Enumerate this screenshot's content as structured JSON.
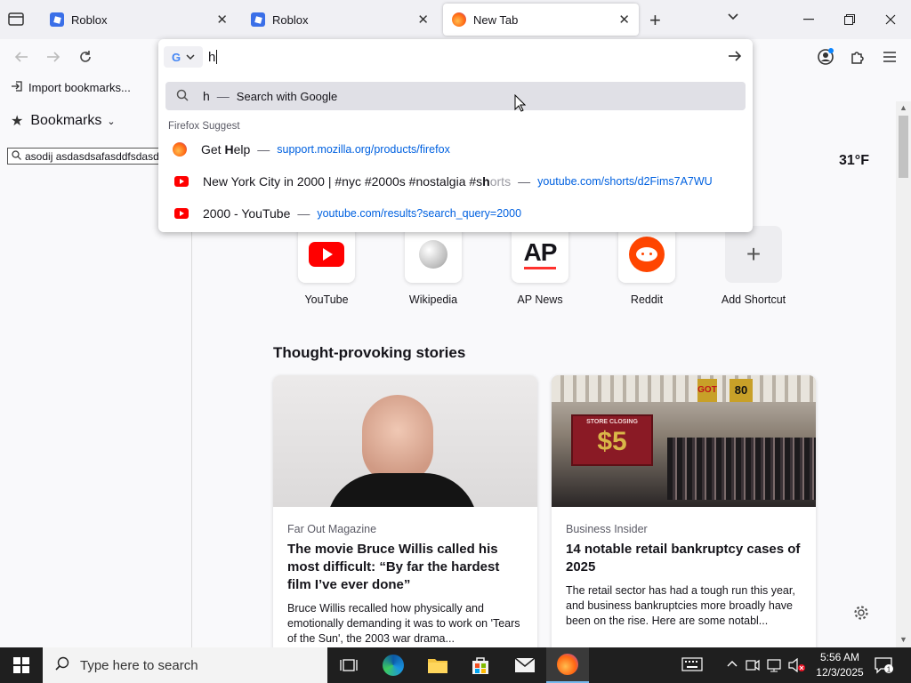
{
  "tabs": [
    {
      "label": "Roblox",
      "active": false
    },
    {
      "label": "Roblox",
      "active": false
    },
    {
      "label": "New Tab",
      "active": true
    }
  ],
  "urlbar": {
    "value": "h"
  },
  "bookmarks_toolbar": {
    "import_label": "Import bookmarks..."
  },
  "sidebar": {
    "title": "Bookmarks",
    "search_value": "asodij asdasdsafasddfsdasda"
  },
  "suggestions": {
    "search_row": {
      "query": "h",
      "text": "Search with Google"
    },
    "section_label": "Firefox Suggest",
    "items": [
      {
        "title_pre": "Get ",
        "title_bold": "H",
        "title_post": "elp",
        "url": "support.mozilla.org/products/firefox",
        "icon": "firefox-icon"
      },
      {
        "title_pre": "New York City in 2000 | #nyc #2000s #nostalgia #s",
        "title_bold": "h",
        "title_post": "orts",
        "url": "youtube.com/shorts/d2Fims7A7WU",
        "icon": "youtube-icon"
      },
      {
        "title_pre": "2000 - YouTube",
        "title_bold": "",
        "title_post": "",
        "url": "youtube.com/results?search_query=2000",
        "icon": "youtube-icon"
      }
    ]
  },
  "weather": {
    "temp": "31°F"
  },
  "shortcuts": [
    {
      "label": "YouTube",
      "icon": "youtube-icon"
    },
    {
      "label": "Wikipedia",
      "icon": "wikipedia-icon"
    },
    {
      "label": "AP News",
      "icon": "apnews-icon"
    },
    {
      "label": "Reddit",
      "icon": "reddit-icon"
    },
    {
      "label": "Add Shortcut",
      "icon": "plus-icon"
    }
  ],
  "stories": {
    "heading": "Thought-provoking stories",
    "cards": [
      {
        "source": "Far Out Magazine",
        "title": "The movie Bruce Willis called his most difficult: “By far the hardest film I’ve ever done”",
        "excerpt": "Bruce Willis recalled how physically and emotionally demanding it was to work on 'Tears of the Sun', the 2003 war drama..."
      },
      {
        "source": "Business Insider",
        "title": "14 notable retail bankruptcy cases of 2025",
        "excerpt": "The retail sector has had a tough run this year, and business bankruptcies more broadly have been on the rise. Here are some notabl...",
        "image_text": {
          "sign1": "STORE CLOSING",
          "sign2": "$5",
          "banner1": "GOT",
          "banner2": "80"
        }
      }
    ]
  },
  "taskbar": {
    "search_placeholder": "Type here to search",
    "time": "5:56 AM",
    "date": "12/3/2025"
  },
  "colors": {
    "accent": "#0061e0",
    "youtube": "#ff0000",
    "reddit": "#ff4500"
  }
}
